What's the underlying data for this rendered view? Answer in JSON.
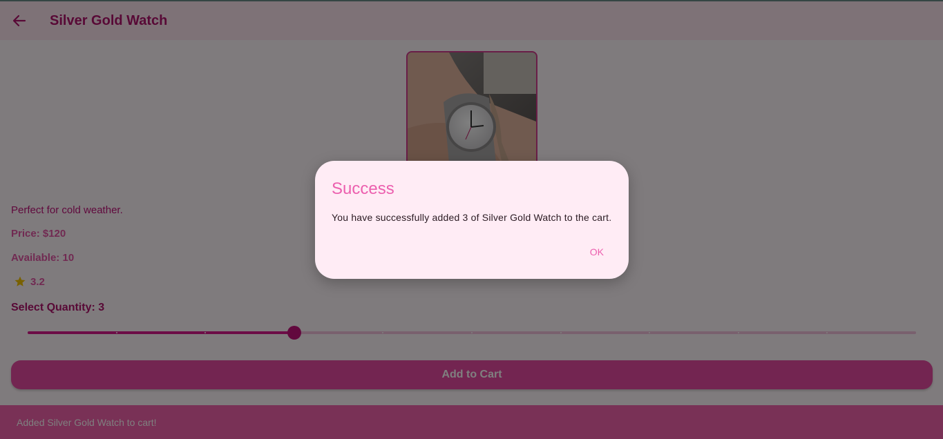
{
  "appbar": {
    "title": "Silver Gold Watch",
    "back_icon": "arrow-left-icon"
  },
  "product": {
    "image_alt": "Silver Gold Watch",
    "description": "Perfect for cold weather.",
    "price": "Price: $120",
    "available": "Available: 10",
    "rating": "3.2",
    "rating_icon": "star-icon"
  },
  "quantity": {
    "label": "Select Quantity: 3",
    "value": 3,
    "min": 0,
    "max": 10
  },
  "buttons": {
    "add_to_cart": "Add to Cart"
  },
  "snackbar": {
    "text": "Added Silver Gold Watch to cart!"
  },
  "dialog": {
    "title": "Success",
    "message": "You have successfully added 3 of Silver Gold Watch to the cart.",
    "ok": "OK"
  },
  "colors": {
    "primary": "#d9188c",
    "accent": "#ec5fae",
    "button": "#e64aa2",
    "star": "#f2c200"
  }
}
